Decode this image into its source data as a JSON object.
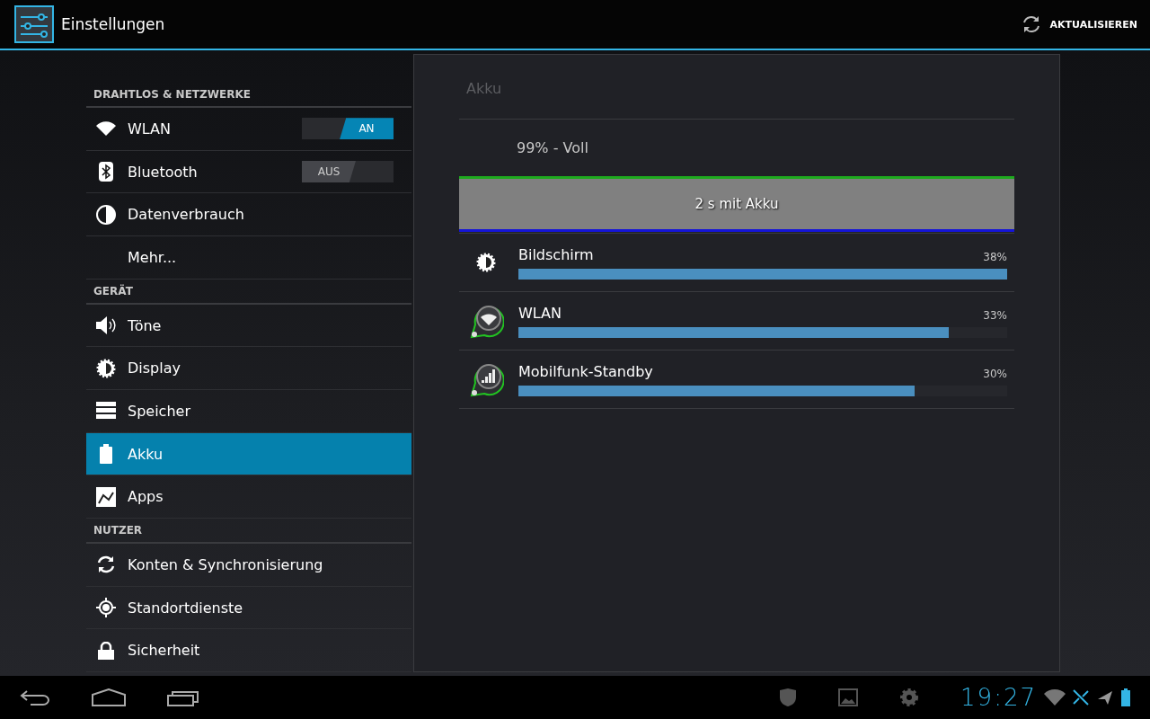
{
  "action_bar": {
    "title": "Einstellungen",
    "action": "AKTUALISIEREN"
  },
  "sidebar": {
    "sections": [
      {
        "header": "DRAHTLOS & NETZWERKE",
        "items": [
          {
            "label": "WLAN",
            "kind": "wifi",
            "selected": false,
            "toggle": {
              "label": "AN",
              "on": true
            }
          },
          {
            "label": "Bluetooth",
            "kind": "bluetooth",
            "selected": false,
            "toggle": {
              "label": "AUS",
              "on": false
            }
          },
          {
            "label": "Datenverbrauch",
            "kind": "data",
            "selected": false
          },
          {
            "label": "Mehr...",
            "kind": "plain",
            "selected": false
          }
        ]
      },
      {
        "header": "GERÄT",
        "items": [
          {
            "label": "Töne",
            "kind": "sound",
            "selected": false
          },
          {
            "label": "Display",
            "kind": "brightness",
            "selected": false
          },
          {
            "label": "Speicher",
            "kind": "storage",
            "selected": false
          },
          {
            "label": "Akku",
            "kind": "battery",
            "selected": true
          },
          {
            "label": "Apps",
            "kind": "apps",
            "selected": false
          }
        ]
      },
      {
        "header": "NUTZER",
        "items": [
          {
            "label": "Konten & Synchronisierung",
            "kind": "sync",
            "selected": false
          },
          {
            "label": "Standortdienste",
            "kind": "location",
            "selected": false
          },
          {
            "label": "Sicherheit",
            "kind": "lock",
            "selected": false
          }
        ]
      }
    ]
  },
  "detail": {
    "title": "Akku",
    "status": "99% - Voll",
    "graph_label": "2 s mit Akku",
    "usage": [
      {
        "name": "Bildschirm",
        "kind": "brightness",
        "percent": "38%",
        "level": 1.0
      },
      {
        "name": "WLAN",
        "kind": "wifi",
        "percent": "33%",
        "level": 0.88
      },
      {
        "name": "Mobilfunk-Standby",
        "kind": "signal",
        "percent": "30%",
        "level": 0.81
      }
    ]
  },
  "status_bar": {
    "time": "19:27"
  }
}
